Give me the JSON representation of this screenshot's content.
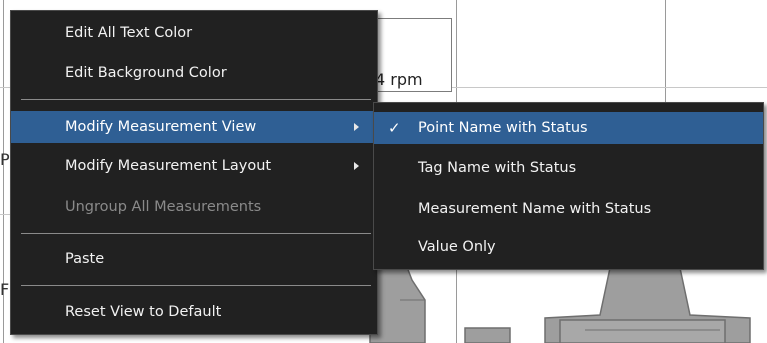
{
  "background": {
    "rpm_value_text": "4  rpm",
    "left_edge_chars": [
      "P",
      "F"
    ]
  },
  "context_menu": {
    "items": [
      {
        "label": "Edit All Text Color"
      },
      {
        "label": "Edit Background Color"
      },
      {
        "label": "Modify Measurement View"
      },
      {
        "label": "Modify Measurement Layout"
      },
      {
        "label": "Ungroup All Measurements"
      },
      {
        "label": "Paste"
      },
      {
        "label": "Reset View to Default"
      }
    ]
  },
  "submenu": {
    "check_mark": "✓",
    "items": [
      {
        "label": "Point Name with Status",
        "checked": true
      },
      {
        "label": "Tag Name with Status",
        "checked": false
      },
      {
        "label": "Measurement Name with Status",
        "checked": false
      },
      {
        "label": "Value Only",
        "checked": false
      }
    ]
  },
  "colors": {
    "menu_background": "#212121",
    "highlight": "#2f5f94",
    "disabled_text": "#8a8a8a",
    "text": "#f2f2f2"
  }
}
